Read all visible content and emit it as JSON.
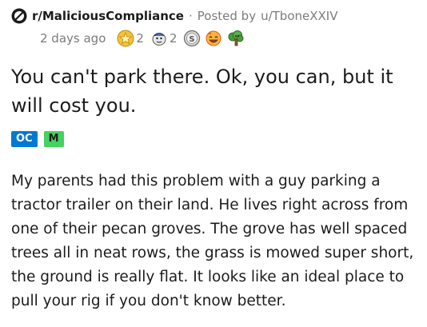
{
  "header": {
    "subreddit": "r/MaliciousCompliance",
    "separator": "·",
    "posted_by_prefix": "Posted by",
    "author": "u/TboneXXIV"
  },
  "meta": {
    "time_ago": "2 days ago",
    "awards": [
      {
        "name": "gold-star-award-icon",
        "count": "2"
      },
      {
        "name": "wholesome-award-icon",
        "count": "2"
      },
      {
        "name": "silver-coin-award-icon",
        "count": ""
      },
      {
        "name": "laughing-face-award-icon",
        "count": ""
      },
      {
        "name": "tree-award-icon",
        "count": ""
      }
    ]
  },
  "post": {
    "title": "You can't park there. Ok, you can, but it will cost you.",
    "flairs": [
      "OC",
      "M"
    ],
    "body": "My parents had this problem with a guy parking a tractor trailer on their land. He lives right across from one of their pecan groves. The grove has well spaced trees all in neat rows, the grass is mowed super short, the ground is really flat. It looks like an ideal place to pull your rig if you don't know better."
  },
  "colors": {
    "text": "#1c1c1c",
    "meta": "#7c7c7c",
    "flair_oc": "#0079d3",
    "flair_m": "#46d160"
  }
}
